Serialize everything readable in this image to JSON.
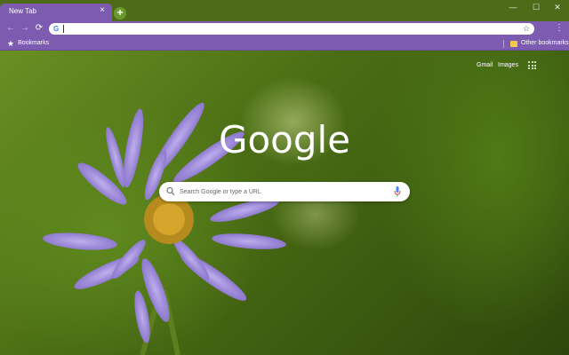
{
  "tab": {
    "title": "New Tab",
    "close": "×",
    "new_tab": "+"
  },
  "window": {
    "minimize": "—",
    "maximize": "☐",
    "close": "✕"
  },
  "toolbar": {
    "back": "←",
    "forward": "→",
    "reload": "⟳",
    "omnibox_value": "",
    "bookmark_star": "☆",
    "menu": "⋮"
  },
  "bookmarks": {
    "label": "Bookmarks",
    "other": "Other bookmarks"
  },
  "page": {
    "gmail": "Gmail",
    "images": "Images",
    "logo": "Google",
    "search_placeholder": "Search Google or type a URL"
  },
  "colors": {
    "theme_purple": "#7c5bb0",
    "frame_green": "#4e6b1a"
  }
}
